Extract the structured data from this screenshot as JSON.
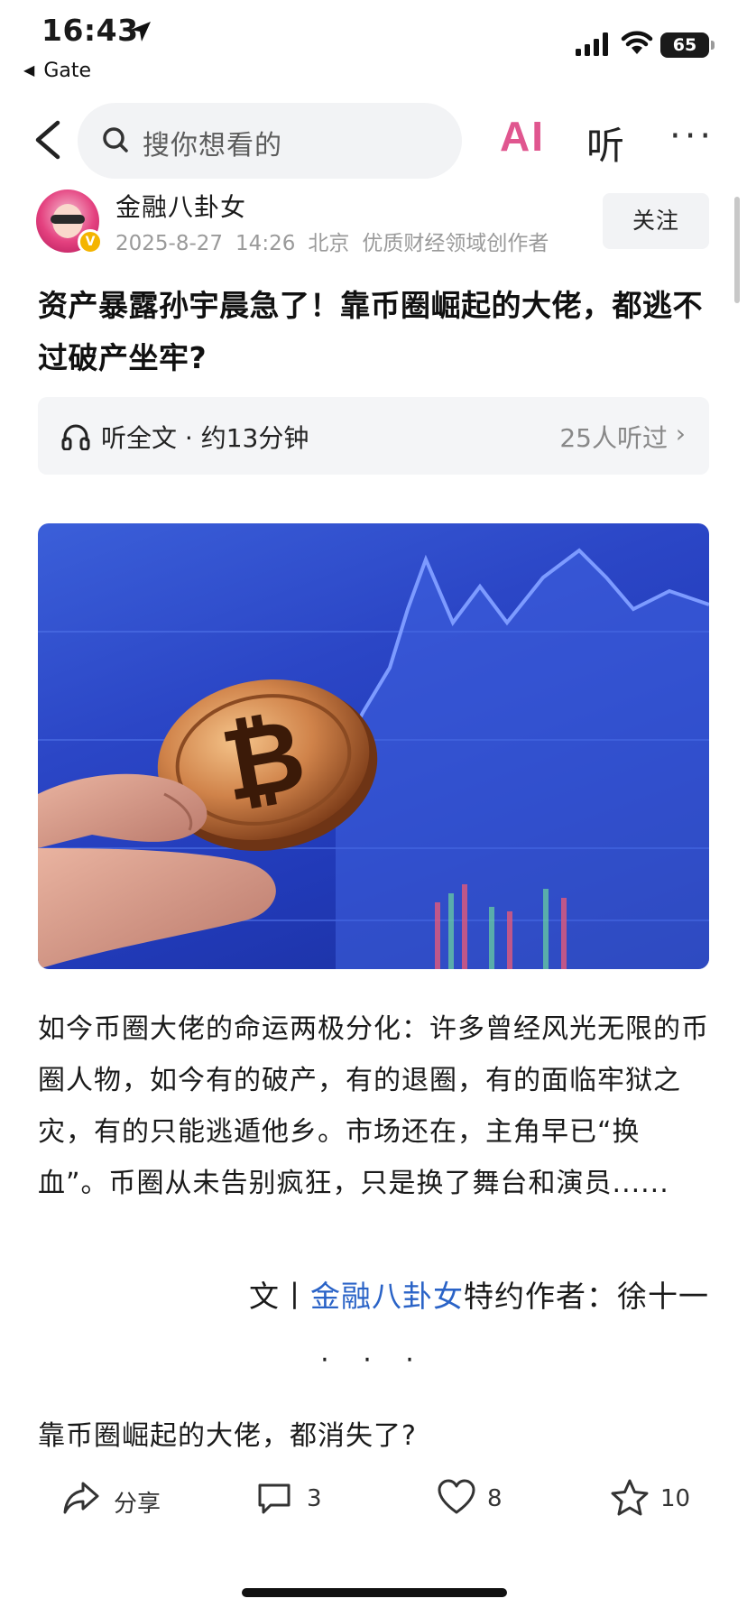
{
  "status_bar": {
    "time": "16:43",
    "back_app": "Gate",
    "battery": "65"
  },
  "nav": {
    "search_placeholder": "搜你想看的",
    "ai_label": "AI",
    "listen_label": "听",
    "more_label": "···",
    "ai_color": "#e0568f"
  },
  "author": {
    "name": "金融八卦女",
    "date": "2025-8-27",
    "time": "14:26",
    "location": "北京",
    "tag": "优质财经领域创作者",
    "verified_badge": "V",
    "follow_label": "关注"
  },
  "article": {
    "title": "资产暴露孙宇晨急了！靠币圈崛起的大佬，都逃不过破产坐牢?",
    "listen_bar": {
      "label": "听全文 · 约13分钟",
      "count": "25人听过",
      "chevron": "›"
    },
    "hero_image": "bitcoin-coin-held-in-fingers-over-blue-stock-chart",
    "body": "如今币圈大佬的命运两极分化：许多曾经风光无限的币圈人物，如今有的破产，有的退圈，有的面临牢狱之灾，有的只能逃遁他乡。市场还在，主角早已“换血”。币圈从未告别疯狂，只是换了舞台和演员......",
    "byline_prefix": "文丨",
    "byline_link": "金融八卦女",
    "byline_suffix": "特约作者：徐十一",
    "separator": "· · ·",
    "section_heading": "靠币圈崛起的大佬，都消失了?"
  },
  "actions": {
    "share_label": "分享",
    "comment_count": "3",
    "like_count": "8",
    "favorite_count": "10"
  },
  "colors": {
    "link": "#2a63c7",
    "hero_blue": "#2b46c6",
    "muted": "#9a9a9a"
  }
}
